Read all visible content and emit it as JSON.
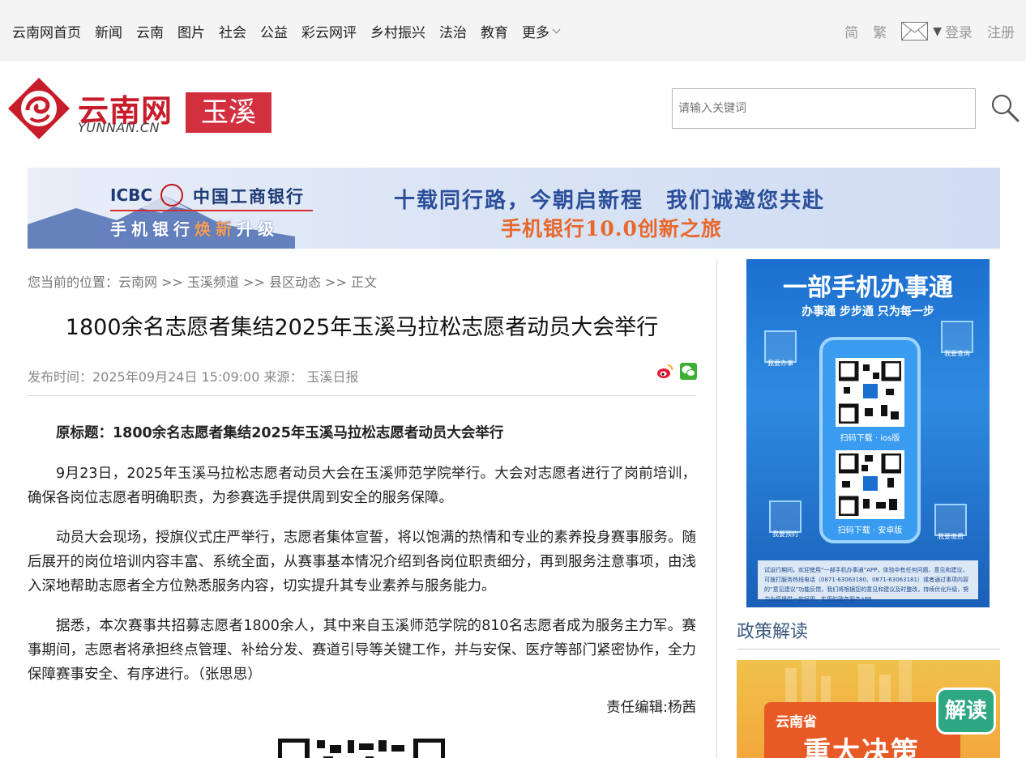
{
  "topnav": {
    "items": [
      "云南网首页",
      "新闻",
      "云南",
      "图片",
      "社会",
      "公益",
      "彩云网评",
      "乡村振兴",
      "法治",
      "教育"
    ],
    "more_label": "更多"
  },
  "topright": {
    "simplified": "简",
    "traditional": "繁",
    "login": "登录",
    "register": "注册"
  },
  "logo": {
    "cn": "云南网",
    "en": "YUNNAN.CN",
    "channel": "玉溪"
  },
  "search": {
    "placeholder": "请输入关键词"
  },
  "banner": {
    "icbc": "ICBC",
    "bank_name": "中国工商银行",
    "upgrade_pre": "手机银行",
    "upgrade_hl": "焕新",
    "upgrade_post": "升级",
    "slogan": "十载同行路，今朝启新程　我们诚邀您共赴",
    "sub": "手机银行10.0创新之旅"
  },
  "breadcrumb": "您当前的位置：云南网 >> 玉溪频道 >> 县区动态 >> 正文",
  "article": {
    "title": "1800余名志愿者集结2025年玉溪马拉松志愿者动员大会举行",
    "meta": "发布时间：2025年09月24日 15:09:00  来源： 玉溪日报",
    "lead": "原标题：1800余名志愿者集结2025年玉溪马拉松志愿者动员大会举行",
    "p1": "9月23日，2025年玉溪马拉松志愿者动员大会在玉溪师范学院举行。大会对志愿者进行了岗前培训，确保各岗位志愿者明确职责，为参赛选手提供周到安全的服务保障。",
    "p2": "动员大会现场，授旗仪式庄严举行，志愿者集体宣誓，将以饱满的热情和专业的素养投身赛事服务。随后展开的岗位培训内容丰富、系统全面，从赛事基本情况介绍到各岗位职责细分，再到服务注意事项，由浅入深地帮助志愿者全方位熟悉服务内容，切实提升其专业素养与服务能力。",
    "p3": "据悉，本次赛事共招募志愿者1800余人，其中来自玉溪师范学院的810名志愿者成为服务主力军。赛事期间，志愿者将承担终点管理、补给分发、赛道引导等关键工作，并与安保、医疗等部门紧密协作，全力保障赛事安全、有序进行。（张思思）",
    "editor": "责任编辑:杨茜"
  },
  "ad": {
    "title": "一部手机办事通",
    "sub": "办事通 步步通 只为每一步",
    "btn_tl": "我要办事",
    "btn_tr": "我要查询",
    "btn_bl": "我要预约",
    "btn_br": "我要缴费",
    "cap1": "扫码下载 · ios版",
    "cap2": "扫码下载 · 安卓版",
    "foot": "试运行期间，欢迎使用“一部手机办事通”APP，体验中有任何问题、意见和建议，可拨打服务热线电话（0871-63063180、0871-63063181）或者通过事项内容的“意见建议”功能反馈，我们将根据您的意见和建议及时整改，持续优化升级，努力为您提供一款好用、实用的政务服务APP。"
  },
  "sidebar": {
    "section_title": "政策解读",
    "policy_prov": "云南省",
    "policy_big": "重大决策",
    "policy_tag": "解读"
  },
  "colors": {
    "brand_red": "#c71d2b",
    "channel_red": "#d3303f",
    "section_blue": "#3a5a7e"
  }
}
